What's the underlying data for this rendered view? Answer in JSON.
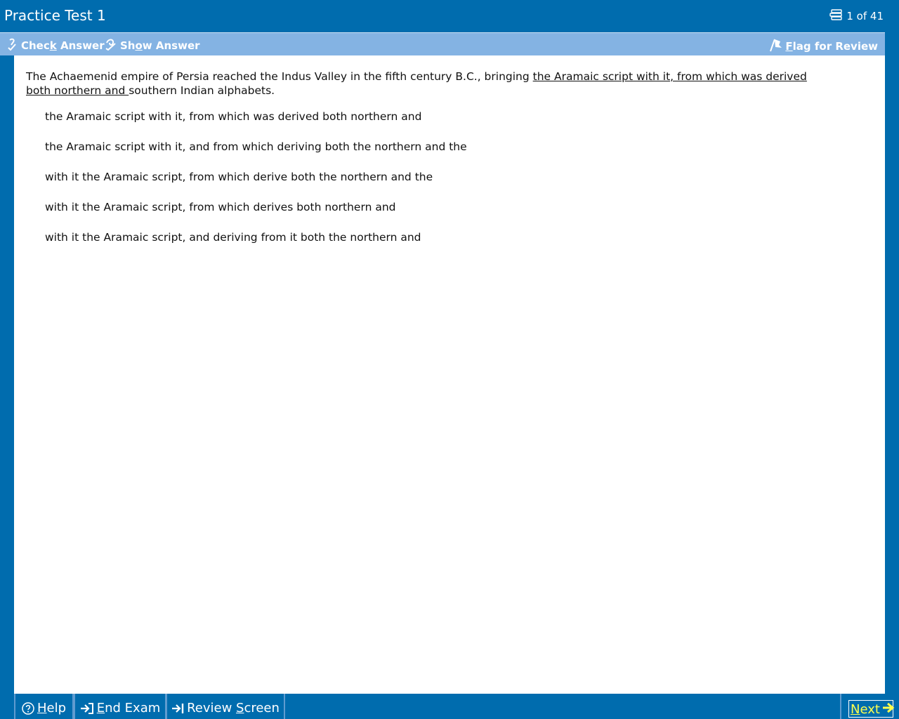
{
  "window": {
    "title": "Practice Test 1",
    "progress": "1 of 41"
  },
  "toolbar": {
    "check_answer": {
      "pre": "Chec",
      "key": "k",
      "post": " Answer"
    },
    "show_answer": {
      "pre": "Sh",
      "key": "o",
      "post": "w Answer"
    },
    "flag_review": {
      "pre": "",
      "key": "F",
      "post": "lag for Review"
    }
  },
  "question": {
    "text_before": "The Achaemenid empire of Persia reached the Indus Valley in the fifth century B.C., bringing ",
    "underlined": "the Aramaic script with it, from which was derived both northern and ",
    "text_after": "southern Indian alphabets.",
    "choices": [
      "the Aramaic script with it, from which was derived both northern and",
      "the Aramaic script with it, and from which deriving both the northern and the",
      "with it the Aramaic script, from which derive both the northern and the",
      "with it the Aramaic script, from which derives both northern and",
      "with it the Aramaic script, and deriving from it both the northern and"
    ]
  },
  "bottom": {
    "help": {
      "pre": "",
      "key": "H",
      "post": "elp"
    },
    "end_exam": {
      "pre": "",
      "key": "E",
      "post": "nd Exam"
    },
    "review_screen": {
      "pre": "Review ",
      "key": "S",
      "post": "creen"
    },
    "next": {
      "pre": "",
      "key": "N",
      "post": "ext"
    }
  },
  "icons": {
    "progress": "stack-icon",
    "check": "check-answer-icon",
    "show": "show-answer-icon",
    "flag": "flag-icon",
    "help": "question-circle-icon",
    "end": "exit-arrow-icon",
    "review": "arrow-to-bar-icon",
    "next": "right-arrow-icon"
  },
  "colors": {
    "frame": "#006cae",
    "toolbar": "#84b3e3",
    "next_text": "#ffff4d"
  }
}
